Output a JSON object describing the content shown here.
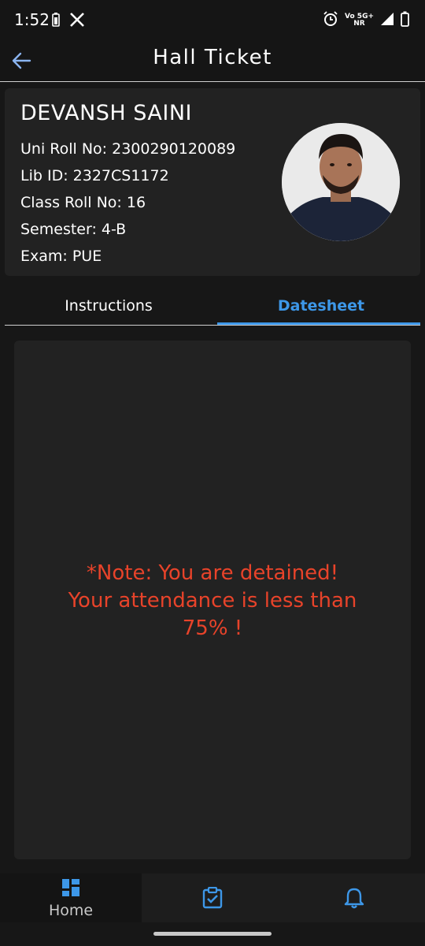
{
  "status_bar": {
    "time": "1:52",
    "network_top": "Vo 5G+",
    "network_bottom": "NR"
  },
  "app_bar": {
    "title": "Hall Ticket"
  },
  "student": {
    "name": "DEVANSH SAINI",
    "details": [
      "Uni Roll No: 2300290120089",
      "Lib ID: 2327CS1172",
      "Class Roll No: 16",
      "Semester: 4-B",
      "Exam: PUE"
    ]
  },
  "tabs": {
    "instructions": "Instructions",
    "datesheet": "Datesheet",
    "active": "Datesheet"
  },
  "content": {
    "note_lines": [
      "*Note: You are detained!",
      "Your attendance is less than",
      "75% !"
    ]
  },
  "bottom_nav": {
    "home_label": "Home",
    "icons": [
      "dashboard-icon",
      "clipboard-check-icon",
      "bell-icon"
    ]
  },
  "colors": {
    "accent": "#3d97e8",
    "warning": "#e8432a",
    "background": "#171717",
    "card": "#222222"
  }
}
